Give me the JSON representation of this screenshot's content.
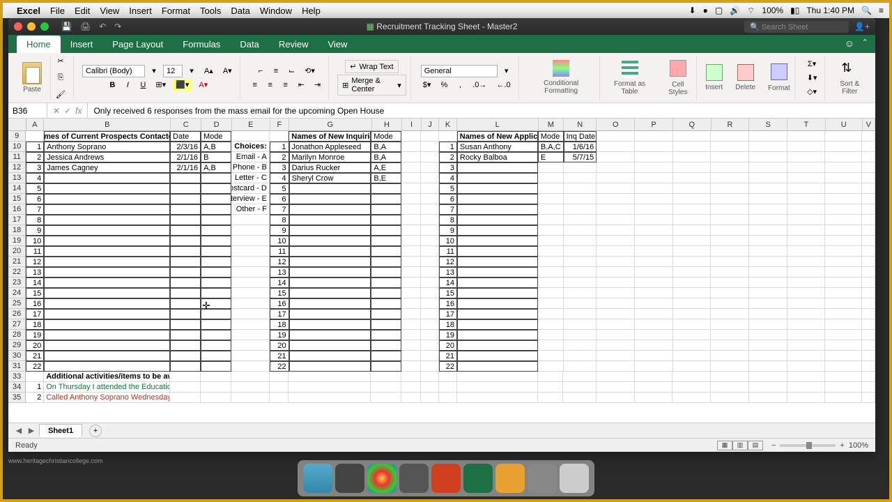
{
  "menubar": {
    "app": "Excel",
    "items": [
      "File",
      "Edit",
      "View",
      "Insert",
      "Format",
      "Tools",
      "Data",
      "Window",
      "Help"
    ],
    "battery": "100%",
    "clock": "Thu 1:40 PM"
  },
  "window": {
    "title": "Recruitment Tracking Sheet - Master2",
    "search_placeholder": "Search Sheet"
  },
  "tabs": [
    "Home",
    "Insert",
    "Page Layout",
    "Formulas",
    "Data",
    "Review",
    "View"
  ],
  "activeTab": "Home",
  "ribbon": {
    "paste": "Paste",
    "font_name": "Calibri (Body)",
    "font_size": "12",
    "wrap": "Wrap Text",
    "merge": "Merge & Center",
    "number_format": "General",
    "cond": "Conditional Formatting",
    "fmt_table": "Format as Table",
    "cell_styles": "Cell Styles",
    "insert": "Insert",
    "delete": "Delete",
    "format": "Format",
    "sort": "Sort & Filter"
  },
  "formula": {
    "cell_ref": "B36",
    "text": "Only received 6 responses from the mass email for the upcoming Open House"
  },
  "cols": {
    "A": 28,
    "B": 200,
    "C": 48,
    "D": 48,
    "E": 60,
    "F": 30,
    "G": 130,
    "H": 48,
    "I": 30,
    "J": 28,
    "K": 28,
    "L": 128,
    "M": 40,
    "N": 52,
    "O": 60,
    "P": 60,
    "Q": 60,
    "R": 60,
    "S": 60,
    "T": 60,
    "U": 58,
    "V": 20
  },
  "headers": {
    "prospects": "Names of Current Prospects Contacted:",
    "date": "Date",
    "mode": "Mode",
    "choices": "Choices:",
    "choice_list": [
      "Email - A",
      "Phone - B",
      "Letter - C",
      "Postcard - D",
      "Interview - E",
      "Other - F"
    ],
    "inquiries": "Names of New Inquiries:",
    "applicants": "Names of New Applicants:",
    "inq_date": "Inq Date",
    "activities": "Additional activities/items to be aware of:"
  },
  "prospects": [
    {
      "n": 1,
      "name": "Anthony Soprano",
      "date": "2/3/16",
      "mode": "A,B"
    },
    {
      "n": 2,
      "name": "Jessica Andrews",
      "date": "2/1/16",
      "mode": "B"
    },
    {
      "n": 3,
      "name": "James Cagney",
      "date": "2/1/16",
      "mode": "A,B"
    }
  ],
  "inquiries": [
    {
      "n": 1,
      "name": "Jonathon Appleseed",
      "mode": "B,A"
    },
    {
      "n": 2,
      "name": "Marilyn Monroe",
      "mode": "B,A"
    },
    {
      "n": 3,
      "name": "Darius Rucker",
      "mode": "A,E"
    },
    {
      "n": 4,
      "name": "Sheryl Crow",
      "mode": "B,E"
    }
  ],
  "applicants": [
    {
      "n": 1,
      "name": "Susan Anthony",
      "mode": "B,A,C",
      "date": "1/6/16"
    },
    {
      "n": 2,
      "name": "Rocky Balboa",
      "mode": "E",
      "date": "5/7/15"
    }
  ],
  "notes": [
    {
      "n": 1,
      "text": "On Thursday I attended the Education Fair sponsored by the Chamber of Commerce. Good turnout, better than expected interest.",
      "color": "green"
    },
    {
      "n": 2,
      "text": "Called Anthony Soprano Wednesday. His employer moved his shift to 2nd. He can no longer enroll in evening classes.",
      "color": "red"
    }
  ],
  "sheet": {
    "name": "Sheet1",
    "status": "Ready",
    "zoom": "100%"
  },
  "watermark": "www.heritagechristiancollege.com"
}
